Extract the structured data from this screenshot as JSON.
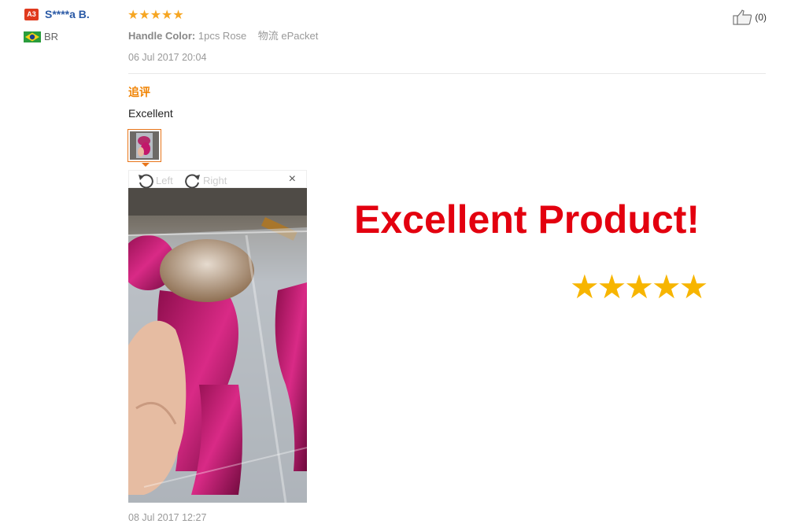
{
  "user": {
    "level_badge": "A3",
    "name": "S****a B.",
    "country_code": "BR"
  },
  "review": {
    "rating_stars": "★★★★★",
    "rating": 5,
    "attr_label": "Handle Color:",
    "attr_value": "1pcs Rose",
    "logistics_label": "物流",
    "logistics_value": "ePacket",
    "date": "06 Jul 2017 20:04",
    "helpful_count": "(0)"
  },
  "followup": {
    "label": "追评",
    "text": "Excellent",
    "viewer": {
      "rotate_left": "Left",
      "rotate_right": "Right",
      "close": "×"
    },
    "date": "08 Jul 2017 12:27"
  },
  "overlay": {
    "title": "Excellent Product!",
    "stars": "★★★★★"
  },
  "colors": {
    "star": "#f6a623",
    "overlay_red": "#e3000f",
    "overlay_star": "#f7b500",
    "link_blue": "#2b5aa6",
    "followup_orange": "#f08200"
  }
}
